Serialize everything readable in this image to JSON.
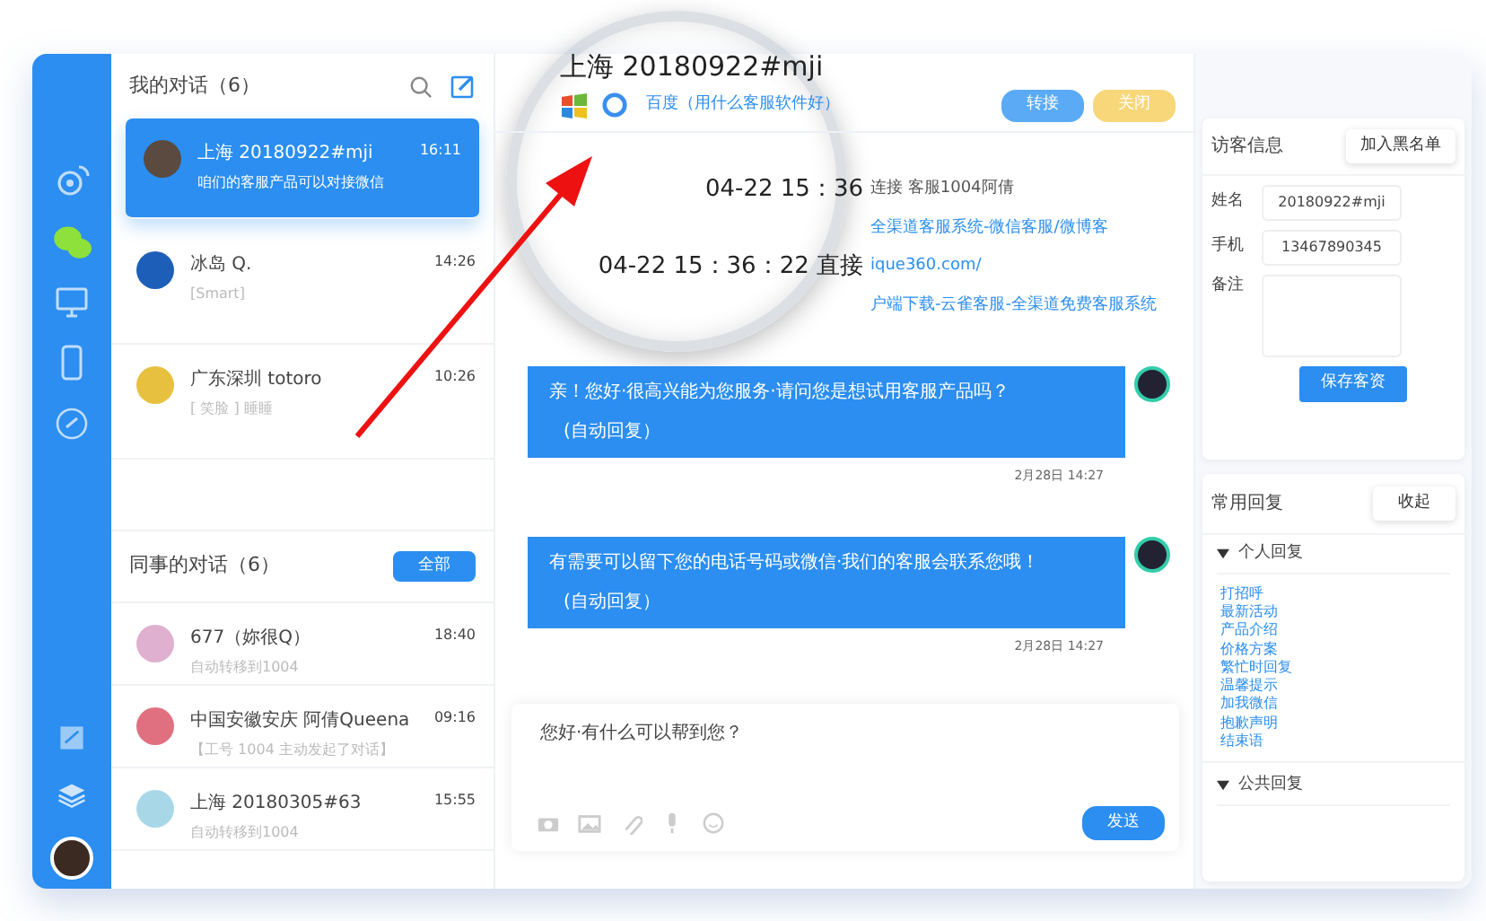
{
  "rail": {
    "icons": [
      {
        "kind": "weibo",
        "selected": false
      },
      {
        "kind": "wechat",
        "selected": true
      },
      {
        "kind": "monitor",
        "selected": false
      },
      {
        "kind": "phone",
        "selected": false
      },
      {
        "kind": "link",
        "selected": false
      }
    ],
    "bottom_icons": [
      {
        "kind": "notes"
      },
      {
        "kind": "layers"
      }
    ]
  },
  "my_chats": {
    "title": "我的对话（6）",
    "items": [
      {
        "name": "上海 20180922#mji",
        "preview": "咱们的客服产品可以对接微信",
        "time": "16:11",
        "selected": true
      },
      {
        "name": "冰岛 Q.",
        "preview": "[Smart]",
        "time": "14:26",
        "selected": false
      },
      {
        "name": "广东深圳 totoro",
        "preview": "[ 笑脸 ] 睡睡",
        "time": "10:26",
        "selected": false
      }
    ]
  },
  "colleague_chats": {
    "title": "同事的对话（6）",
    "button": "全部",
    "items": [
      {
        "name": "677（妳很Q）",
        "preview": "自动转移到1004",
        "time": "18:40"
      },
      {
        "name": "中国安徽安庆 阿倩Queena",
        "preview": "【工号 1004 主动发起了对话】",
        "time": "09:16"
      },
      {
        "name": "上海 20180305#63",
        "preview": "自动转移到1004",
        "time": "15:55"
      }
    ]
  },
  "chat": {
    "title": "上海 20180922#mji",
    "source": "百度（用什么客服软件好）",
    "buttons": [
      {
        "label": "转接",
        "kind": "transfer"
      },
      {
        "label": "关闭",
        "kind": "close"
      }
    ],
    "log": [
      [
        {
          "text": "04-22 15：36",
          "kind": "zoomed"
        },
        {
          "text": "连接 客服1004阿倩",
          "kind": "plain"
        }
      ],
      [
        {
          "text": "全渠道客服系统-微信客服/微博客",
          "kind": "link"
        }
      ],
      [
        {
          "text": "04-22 15：36：22 直接",
          "kind": "zoomed"
        },
        {
          "text": "ique360.com/",
          "kind": "link"
        }
      ],
      [
        {
          "text": "户端下载-云雀客服-全渠道免费客服系统",
          "kind": "link"
        }
      ]
    ],
    "messages": [
      {
        "text": "亲！您好·很高兴能为您服务·请问您是想试用客服产品吗？",
        "note": "(自动回复）",
        "time": "2月28日 14:27"
      },
      {
        "text": "有需要可以留下您的电话号码或微信·我们的客服会联系您哦！",
        "note": "(自动回复）",
        "time": "2月28日 14:27"
      }
    ],
    "composer": {
      "value": "您好·有什么可以帮到您？",
      "send": "发送"
    }
  },
  "visitor": {
    "title": "访客信息",
    "blacklist": "加入黑名单",
    "name_label": "姓名",
    "name": "20180922#mji",
    "phone_label": "手机",
    "phone": "13467890345",
    "note_label": "备注",
    "save": "保存客资"
  },
  "quick_replies": {
    "title": "常用回复",
    "collapse": "收起",
    "groups": [
      {
        "title": "个人回复",
        "expanded": true,
        "items": [
          "打招呼",
          "最新活动",
          "产品介绍",
          "价格方案",
          "繁忙时回复",
          "温馨提示",
          "加我微信",
          "抱歉声明",
          "结束语"
        ]
      },
      {
        "title": "公共回复",
        "expanded": true
      }
    ]
  }
}
